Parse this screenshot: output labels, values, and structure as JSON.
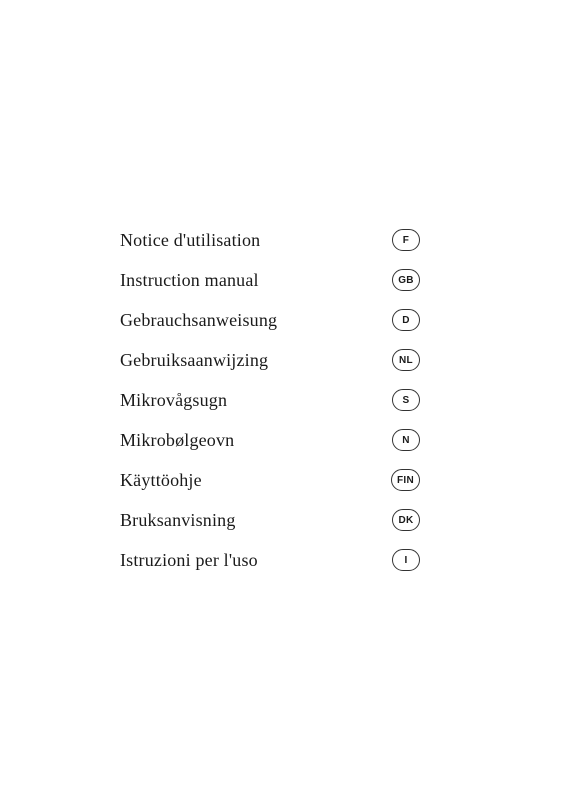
{
  "menu": {
    "items": [
      {
        "label": "Notice d'utilisation",
        "badge": "F"
      },
      {
        "label": "Instruction manual",
        "badge": "GB"
      },
      {
        "label": "Gebrauchsanweisung",
        "badge": "D"
      },
      {
        "label": "Gebruiksaanwijzing",
        "badge": "NL"
      },
      {
        "label": "Mikrovågsugn",
        "badge": "S"
      },
      {
        "label": "Mikrobølgeovn",
        "badge": "N"
      },
      {
        "label": "Käyttöohje",
        "badge": "FIN"
      },
      {
        "label": "Bruksanvisning",
        "badge": "DK"
      },
      {
        "label": "Istruzioni per l'uso",
        "badge": "I"
      }
    ]
  }
}
